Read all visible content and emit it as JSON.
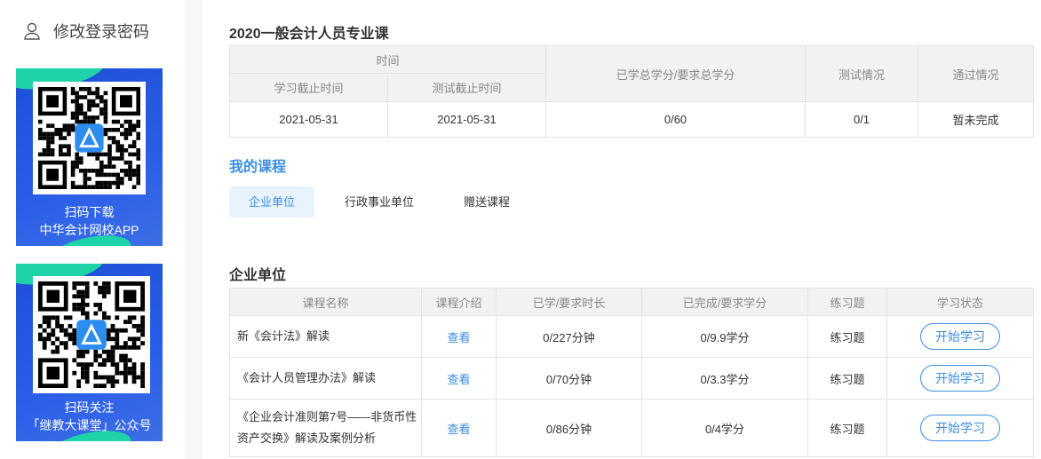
{
  "sidebar": {
    "change_password": "修改登录密码",
    "promos": [
      {
        "line1": "扫码下载",
        "line2": "中华会计网校APP"
      },
      {
        "line1": "扫码关注",
        "line2": "「继教大课堂」公众号"
      }
    ]
  },
  "summary": {
    "title": "2020一般会计人员专业课",
    "headers": {
      "time": "时间",
      "study_deadline": "学习截止时间",
      "test_deadline": "测试截止时间",
      "credits": "已学总学分/要求总学分",
      "test": "测试情况",
      "pass": "通过情况"
    },
    "row": {
      "study_deadline": "2021-05-31",
      "test_deadline": "2021-05-31",
      "credits": "0/60",
      "test": "0/1",
      "pass": "暂未完成"
    }
  },
  "my_courses": {
    "title": "我的课程",
    "tabs": [
      "企业单位",
      "行政事业单位",
      "赠送课程"
    ],
    "active_tab": 0
  },
  "course_section": {
    "title": "企业单位",
    "headers": [
      "课程名称",
      "课程介绍",
      "已学/要求时长",
      "已完成/要求学分",
      "练习题",
      "学习状态"
    ],
    "rows": [
      {
        "name": "新《会计法》解读",
        "intro": "查看",
        "duration": "0/227分钟",
        "credits": "0/9.9学分",
        "exercise": "练习题",
        "action": "开始学习"
      },
      {
        "name": "《会计人员管理办法》解读",
        "intro": "查看",
        "duration": "0/70分钟",
        "credits": "0/3.3学分",
        "exercise": "练习题",
        "action": "开始学习"
      },
      {
        "name": "《企业会计准则第7号——非货币性资产交换》解读及案例分析",
        "intro": "查看",
        "duration": "0/86分钟",
        "credits": "0/4学分",
        "exercise": "练习题",
        "action": "开始学习"
      }
    ]
  },
  "colors": {
    "accent": "#3a8ee6",
    "promo_bg": "#2a5ee8",
    "promo_swoosh": "#1fd3a8"
  }
}
